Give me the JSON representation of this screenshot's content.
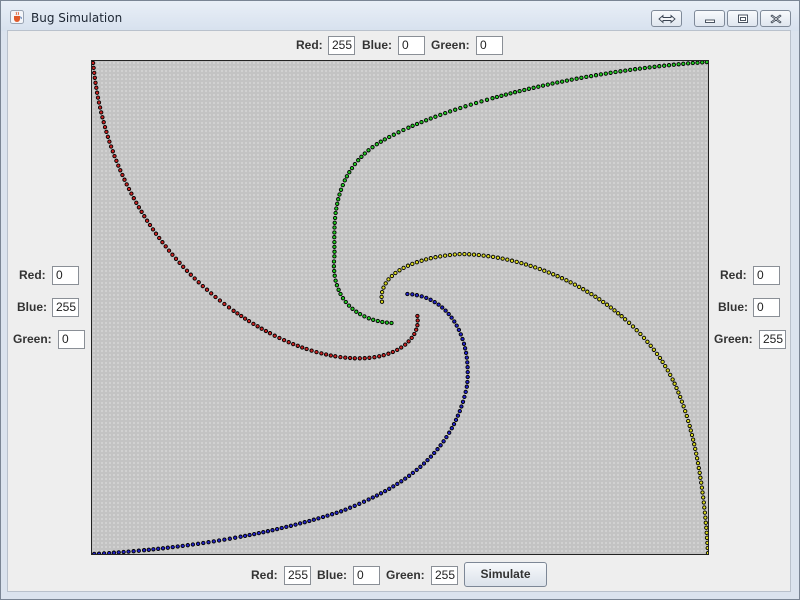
{
  "window": {
    "title": "Bug Simulation",
    "icon": "java-cup-icon",
    "controls": [
      "restore-icon",
      "minimize-icon",
      "maximize-icon",
      "close-icon"
    ]
  },
  "top_panel": {
    "red_label": "Red:",
    "red_value": "255",
    "blue_label": "Blue:",
    "blue_value": "0",
    "green_label": "Green:",
    "green_value": "0"
  },
  "left_panel": {
    "red_label": "Red:",
    "red_value": "0",
    "blue_label": "Blue:",
    "blue_value": "255",
    "green_label": "Green:",
    "green_value": "0"
  },
  "right_panel": {
    "red_label": "Red:",
    "red_value": "0",
    "blue_label": "Blue:",
    "blue_value": "0",
    "green_label": "Green:",
    "green_value": "255"
  },
  "bottom_panel": {
    "red_label": "Red:",
    "red_value": "255",
    "blue_label": "Blue:",
    "blue_value": "0",
    "green_label": "Green:",
    "green_value": "255",
    "simulate_label": "Simulate"
  },
  "canvas": {
    "background": "#c3c3c3",
    "dot_outline": "#000000",
    "trails": [
      {
        "name": "green",
        "color": "#22cc22"
      },
      {
        "name": "red",
        "color": "#cc2222"
      },
      {
        "name": "blue",
        "color": "#2222cc"
      },
      {
        "name": "yellow",
        "color": "#dddd22"
      }
    ]
  }
}
